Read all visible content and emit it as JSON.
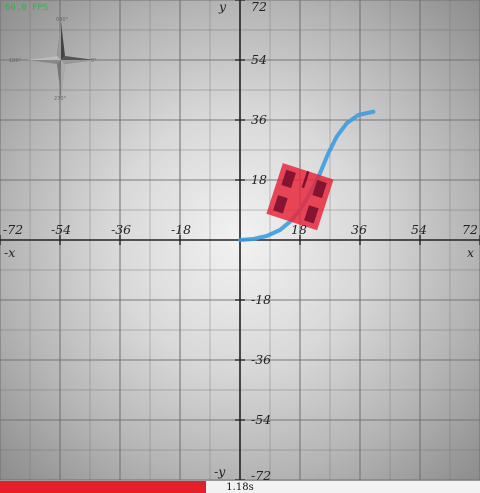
{
  "status": {
    "fps_text": "60.0 FPS"
  },
  "compass": {
    "north": "090°",
    "east": "0°",
    "south": "270°",
    "west": "180°"
  },
  "plane": {
    "x_axis_label": "x",
    "x_axis_neg_label": "-x",
    "y_axis_label": "y",
    "y_axis_neg_label": "-y",
    "range": [
      -72,
      72
    ],
    "grid_step": 9,
    "tick_step": 18,
    "x_tick_labels": [
      "-72",
      "-54",
      "-36",
      "-18",
      "18",
      "36",
      "54",
      "72"
    ],
    "y_tick_labels": [
      "72",
      "54",
      "36",
      "18",
      "-18",
      "-36",
      "-54",
      "-72"
    ],
    "colors": {
      "axis": "#222222",
      "grid": "#6e6e6e",
      "path": "#3d9be0",
      "robot": "#e8283c",
      "wheel": "#7a1030"
    }
  },
  "robot": {
    "center": [
      18,
      13
    ],
    "heading_deg": 72,
    "size": 16,
    "path": [
      [
        0,
        0
      ],
      [
        4,
        0.3
      ],
      [
        8,
        1.2
      ],
      [
        12,
        3
      ],
      [
        15,
        5.5
      ],
      [
        18,
        9
      ],
      [
        21,
        14
      ],
      [
        24,
        20
      ],
      [
        26.5,
        26
      ],
      [
        29,
        31
      ],
      [
        32,
        35
      ],
      [
        35.5,
        37.5
      ],
      [
        40,
        38.5
      ]
    ]
  },
  "timeline": {
    "time_label": "1.18s",
    "progress": 0.43
  }
}
